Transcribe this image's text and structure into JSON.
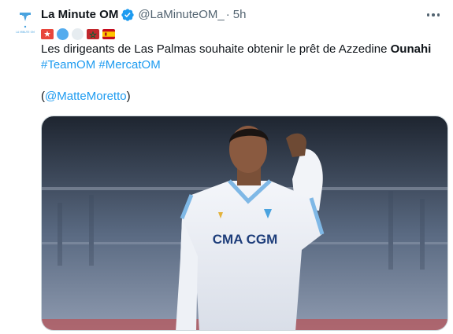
{
  "tweet": {
    "display_name": "La Minute OM",
    "handle": "@LaMinuteOM_",
    "separator": "·",
    "time": "5h",
    "text_before": "Les dirigeants de Las Palmas souhaite obtenir le prêt de Azzedine ",
    "text_bold": "Ounahi",
    "hashtags": [
      "#TeamOM",
      "#MercatOM"
    ],
    "source_open": "(",
    "source_mention": "@MatteMoretto",
    "source_close": ")",
    "shirt_sponsor": "CMA CGM",
    "avatar_logo_text": "LA MINUTE OM"
  },
  "icons": {
    "verified": "verified-badge-icon",
    "more": "more-options-icon",
    "badges": [
      "om-badge-icon",
      "blue-circle-icon",
      "white-circle-icon",
      "morocco-flag-icon",
      "spain-flag-icon"
    ]
  },
  "colors": {
    "link": "#1d9bf0",
    "verified": "#1d9bf0",
    "text": "#0f1419",
    "secondary": "#536471"
  }
}
